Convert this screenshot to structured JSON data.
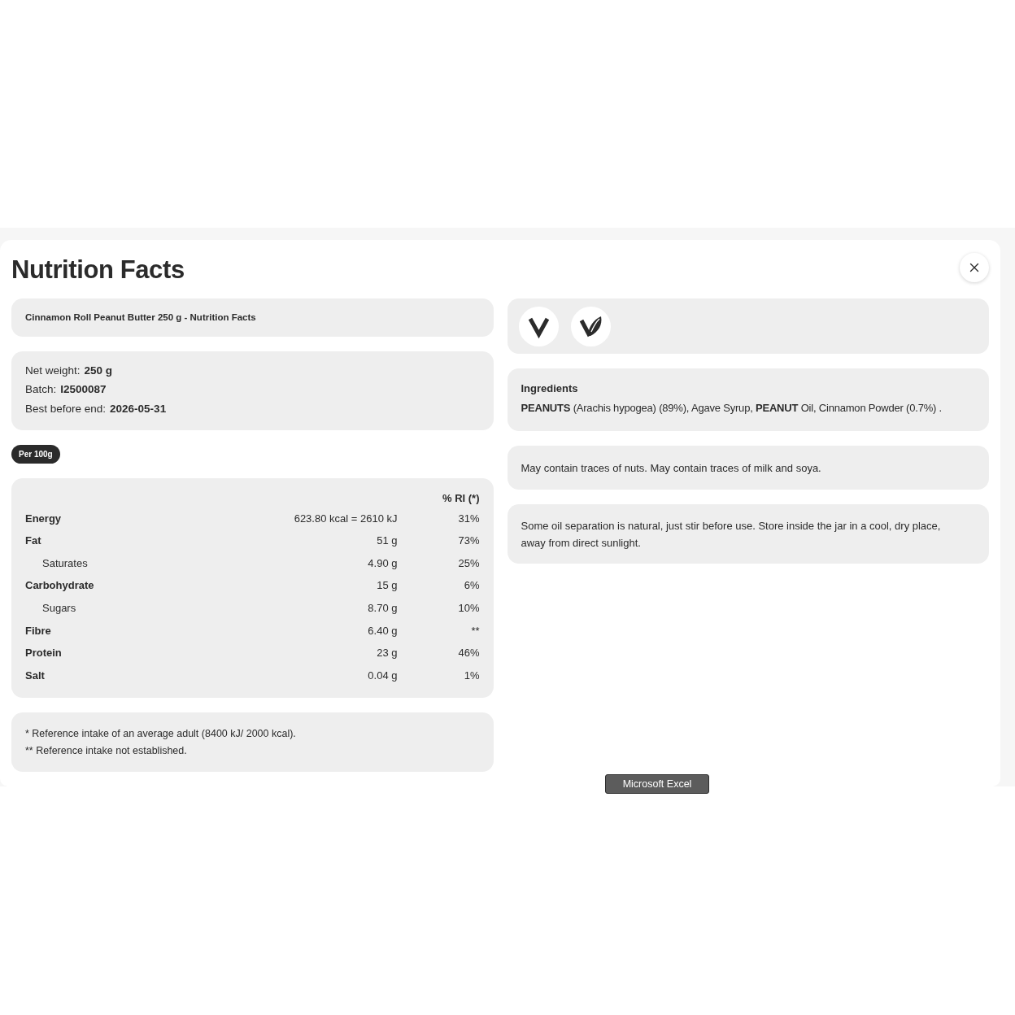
{
  "dialog": {
    "title": "Nutrition Facts"
  },
  "product": {
    "title": "Cinnamon Roll Peanut Butter 250 g - Nutrition Facts"
  },
  "details": [
    {
      "label": "Net weight:",
      "value": "250 g"
    },
    {
      "label": "Batch:",
      "value": "I2500087"
    },
    {
      "label": "Best before end:",
      "value": "2026-05-31"
    }
  ],
  "basis_badge": "Per 100g",
  "nutrition_table": {
    "ri_header": "% RI (*)",
    "rows": [
      {
        "name": "Energy",
        "amount": "623.80 kcal = 2610 kJ",
        "ri": "31%"
      },
      {
        "name": "Fat",
        "amount": "51 g",
        "ri": "73%",
        "children": [
          {
            "name": "Saturates",
            "amount": "4.90 g",
            "ri": "25%"
          }
        ]
      },
      {
        "name": "Carbohydrate",
        "amount": "15 g",
        "ri": "6%",
        "children": [
          {
            "name": "Sugars",
            "amount": "8.70 g",
            "ri": "10%"
          }
        ]
      },
      {
        "name": "Fibre",
        "amount": "6.40 g",
        "ri": "**"
      },
      {
        "name": "Protein",
        "amount": "23 g",
        "ri": "46%"
      },
      {
        "name": "Salt",
        "amount": "0.04 g",
        "ri": "1%"
      }
    ]
  },
  "footnotes": [
    "* Reference intake of an average adult (8400 kJ/ 2000 kcal).",
    "** Reference intake not established."
  ],
  "ingredients": {
    "heading": "Ingredients",
    "text": "**PEANUTS** (Arachis hypogea) (89%), Agave Syrup, **PEANUT** Oil, Cinnamon Powder (0.7%) ."
  },
  "allergens": "May contain traces of nuts. May contain traces of milk and soya.",
  "storage": "Some oil separation is natural, just stir before use. Store inside the jar in a cool, dry place, away from direct sunlight.",
  "tooltip": "Microsoft Excel"
}
